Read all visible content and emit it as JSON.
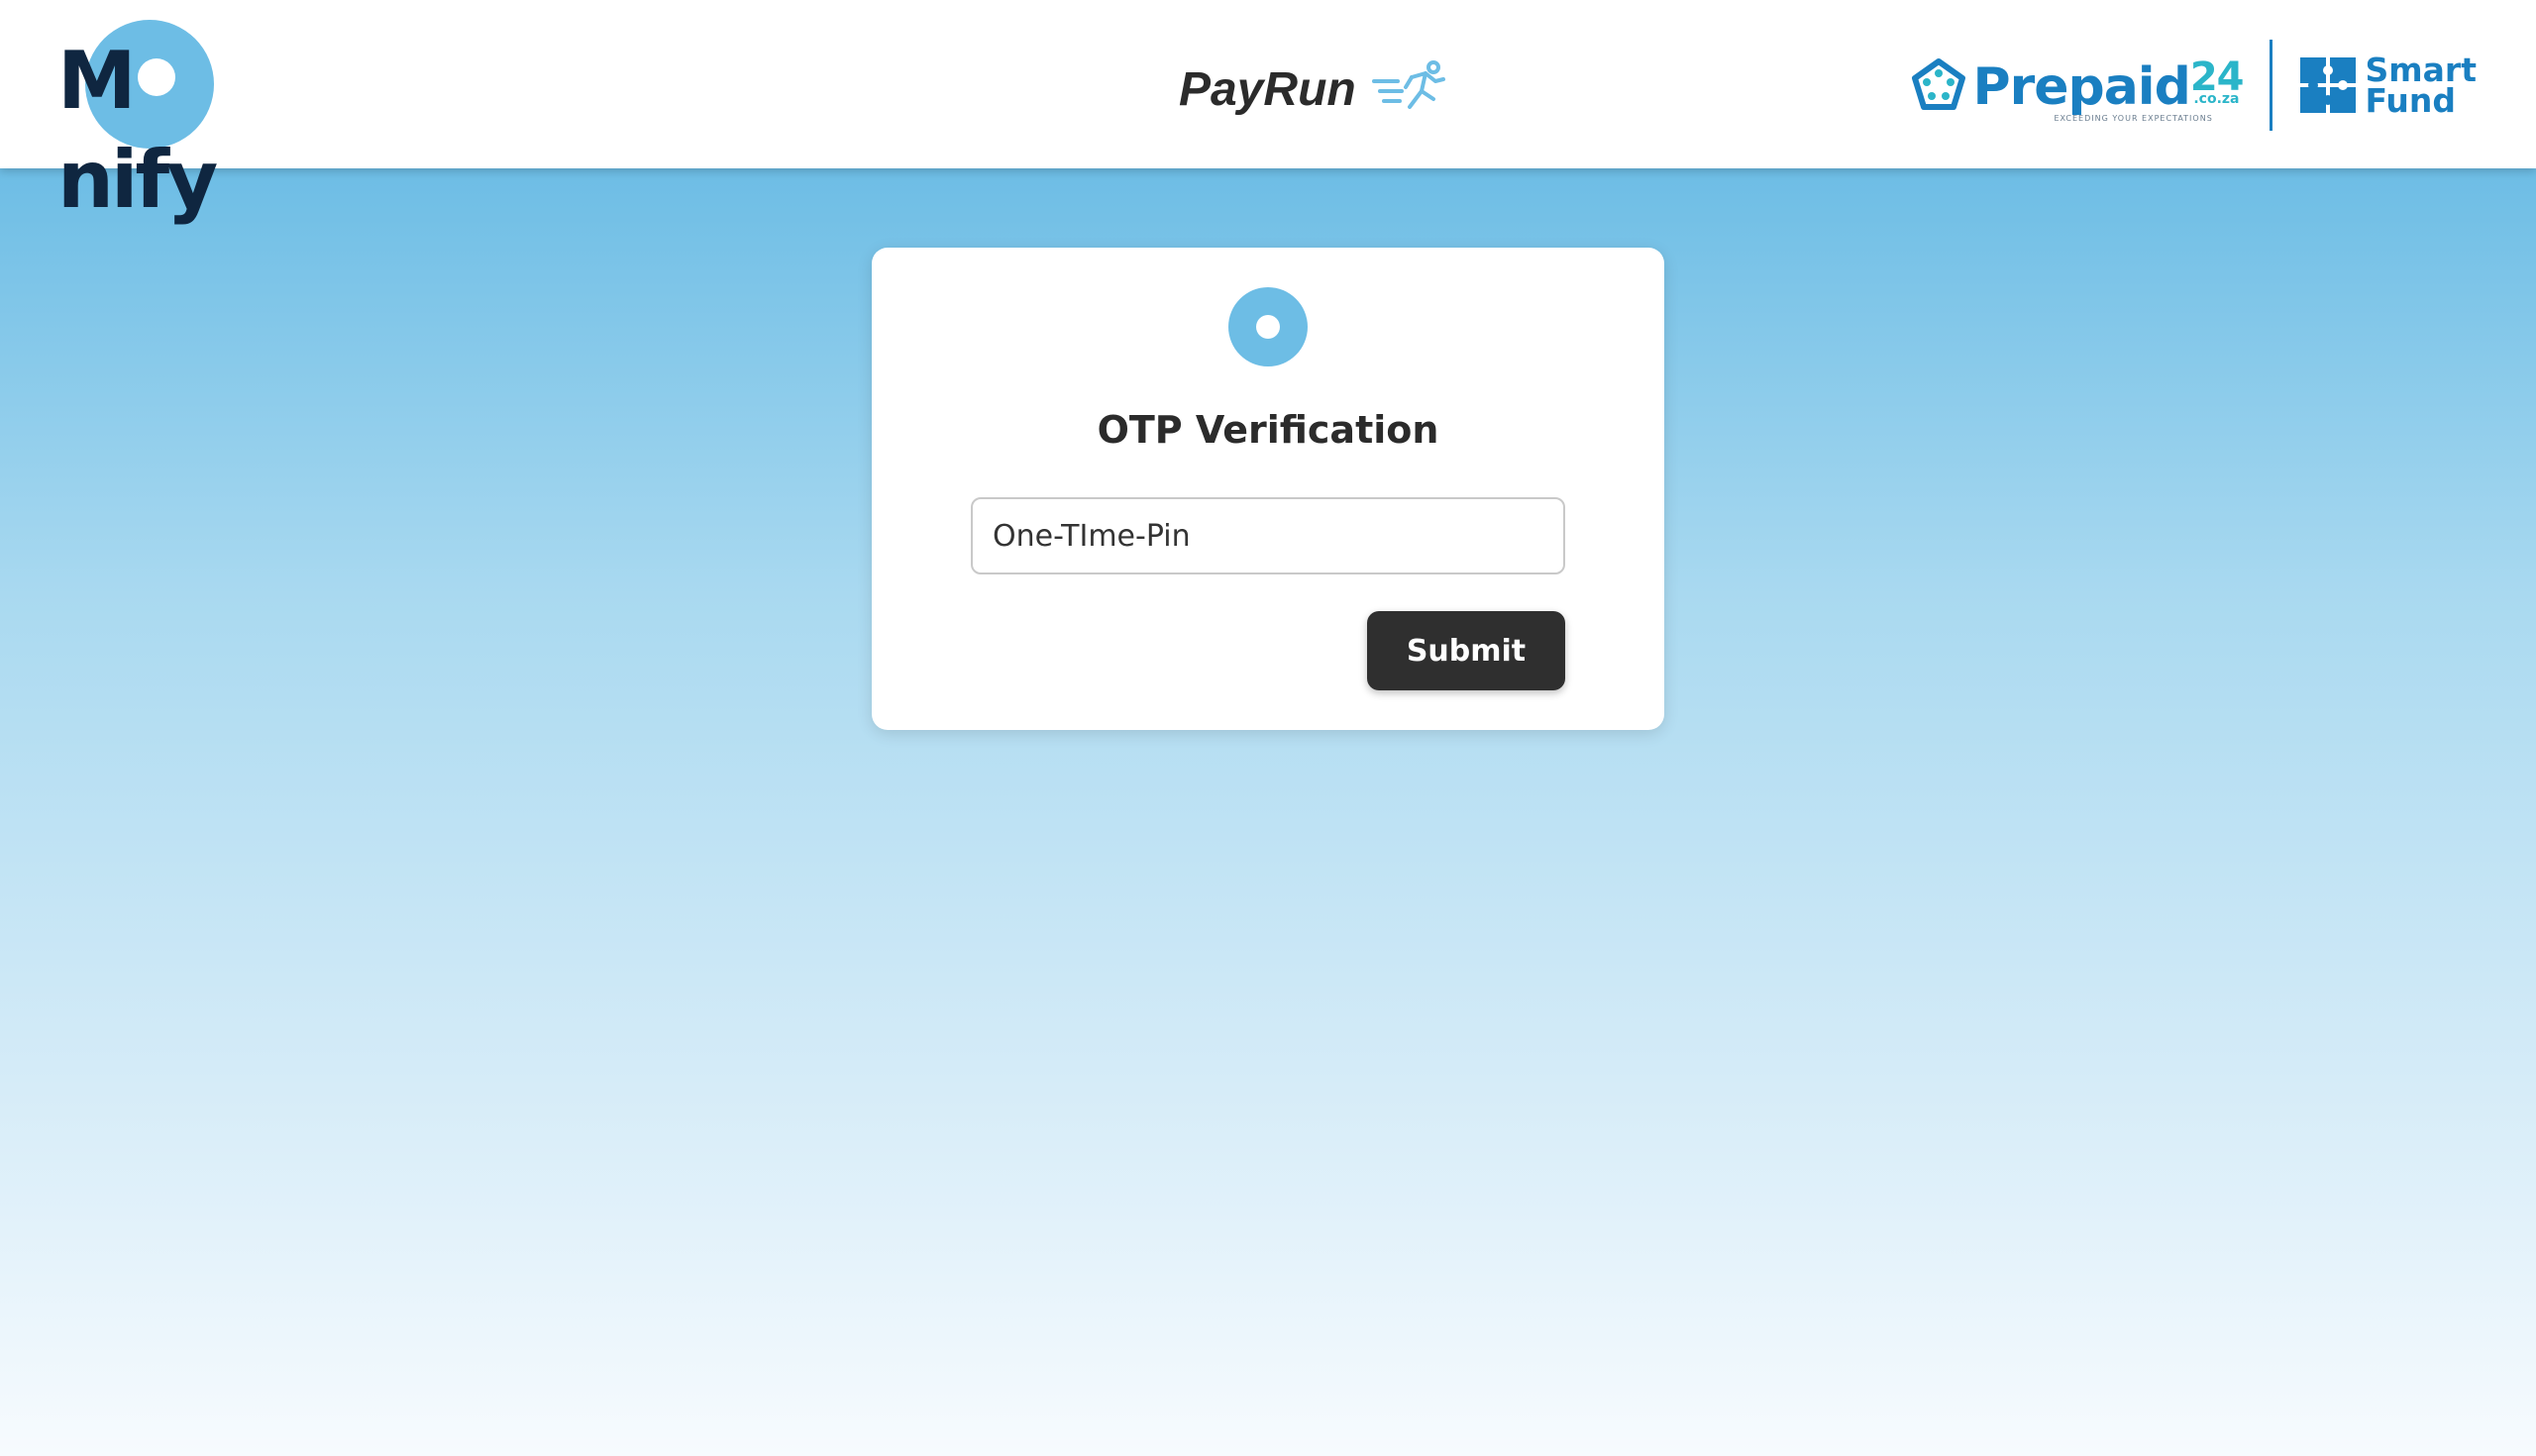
{
  "brand": {
    "monify_text_pre": "M",
    "monify_text_post": "nify",
    "colors": {
      "monify_circle": "#6dbde5",
      "monify_text": "#0f2640"
    }
  },
  "header": {
    "center_title": "PayRun",
    "center_icon": "runner-icon",
    "partners": {
      "prepaid": {
        "name": "Prepaid",
        "number": "24",
        "suffix": ".co.za",
        "tagline": "EXCEEDING YOUR EXPECTATIONS",
        "icon": "pentagon-logo-icon"
      },
      "smartfund": {
        "line1": "Smart",
        "line2": "Fund",
        "icon": "puzzle-icon"
      }
    }
  },
  "otp_card": {
    "logo_icon": "monify-circle-icon",
    "title": "OTP Verification",
    "input_placeholder": "One-TIme-Pin",
    "input_value": "",
    "submit_label": "Submit"
  },
  "colors": {
    "background_top": "#6dbde5",
    "background_bottom": "#f7fbfe",
    "submit_button": "#2f2f2f",
    "partner_blue": "#1a7fc1"
  }
}
